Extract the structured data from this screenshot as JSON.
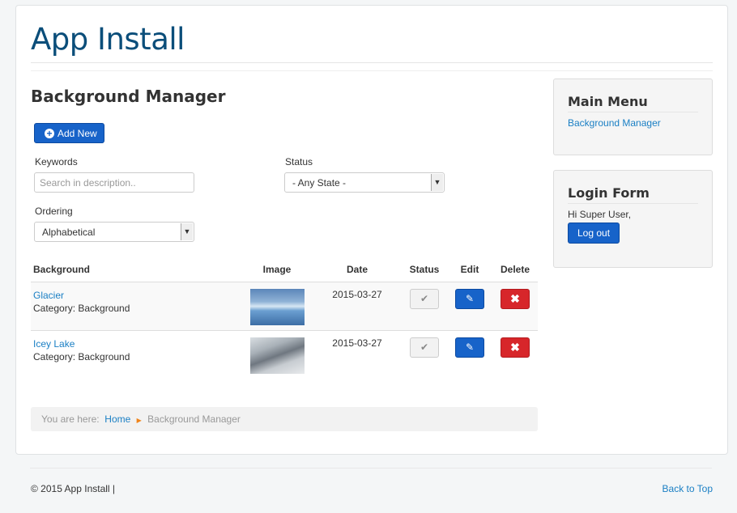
{
  "site_title": "App Install",
  "page_heading": "Background Manager",
  "add_new_label": "Add New",
  "filters": {
    "keywords_label": "Keywords",
    "keywords_placeholder": "Search in description..",
    "status_label": "Status",
    "status_value": "- Any State -",
    "ordering_label": "Ordering",
    "ordering_value": "Alphabetical"
  },
  "table": {
    "headers": [
      "Background",
      "Image",
      "Date",
      "Status",
      "Edit",
      "Delete"
    ],
    "rows": [
      {
        "name": "Glacier",
        "category": "Category: Background",
        "date": "2015-03-27"
      },
      {
        "name": "Icey Lake",
        "category": "Category: Background",
        "date": "2015-03-27"
      }
    ]
  },
  "breadcrumb": {
    "prefix": "You are here:",
    "home": "Home",
    "current": "Background Manager"
  },
  "sidebar": {
    "main_menu_title": "Main Menu",
    "main_menu_item": "Background Manager",
    "login_title": "Login Form",
    "greeting": "Hi Super User,",
    "logout_label": "Log out"
  },
  "footer": {
    "copyright": "© 2015 App Install",
    "back_to_top": "Back to Top"
  },
  "icons": {
    "add": "plus-circle-icon",
    "status": "check-icon",
    "edit": "edit-icon",
    "delete": "close-icon",
    "breadcrumb_sep": "triangle-right-icon"
  },
  "colors": {
    "title": "#0b4e7a",
    "primary": "#1763c9",
    "danger": "#d7262a",
    "link": "#1a7fc4"
  }
}
